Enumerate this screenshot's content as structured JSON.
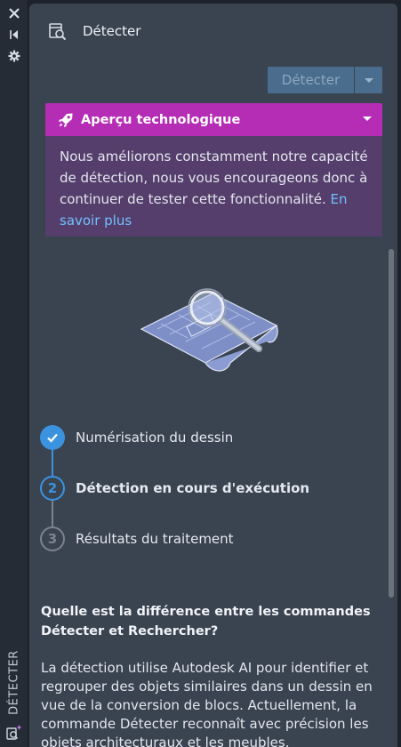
{
  "strip": {
    "icons": [
      "close-icon",
      "collapse-icon",
      "gear-icon",
      "detect-sparkle-icon"
    ],
    "vertical_label": "DÉTECTER"
  },
  "header": {
    "title": "Détecter",
    "icon": "detect-icon"
  },
  "toolbar": {
    "detect_label": "Détecter",
    "detect_enabled": false
  },
  "preview": {
    "title": "Aperçu technologique",
    "body": "Nous améliorons constamment notre capacité de détection, nous vous encourageons donc à continuer de tester cette fonctionnalité. ",
    "link": "En savoir plus",
    "colors": {
      "header": "#b52cb5",
      "body": "#553e6b"
    }
  },
  "steps": [
    {
      "number": "1",
      "label": "Numérisation du dessin",
      "state": "done"
    },
    {
      "number": "2",
      "label": "Détection en cours d'exécution",
      "state": "active"
    },
    {
      "number": "3",
      "label": "Résultats du traitement",
      "state": "pending"
    }
  ],
  "faq": {
    "question": "Quelle est la différence entre les commandes Détecter et Rechercher?",
    "answer": "La détection utilise Autodesk AI pour identifier et regrouper des objets similaires dans un dessin en vue de la conversion de blocs. Actuellement, la commande Détecter reconnaît avec précision les objets architecturaux et les meubles."
  },
  "accent": "#3b93e0"
}
